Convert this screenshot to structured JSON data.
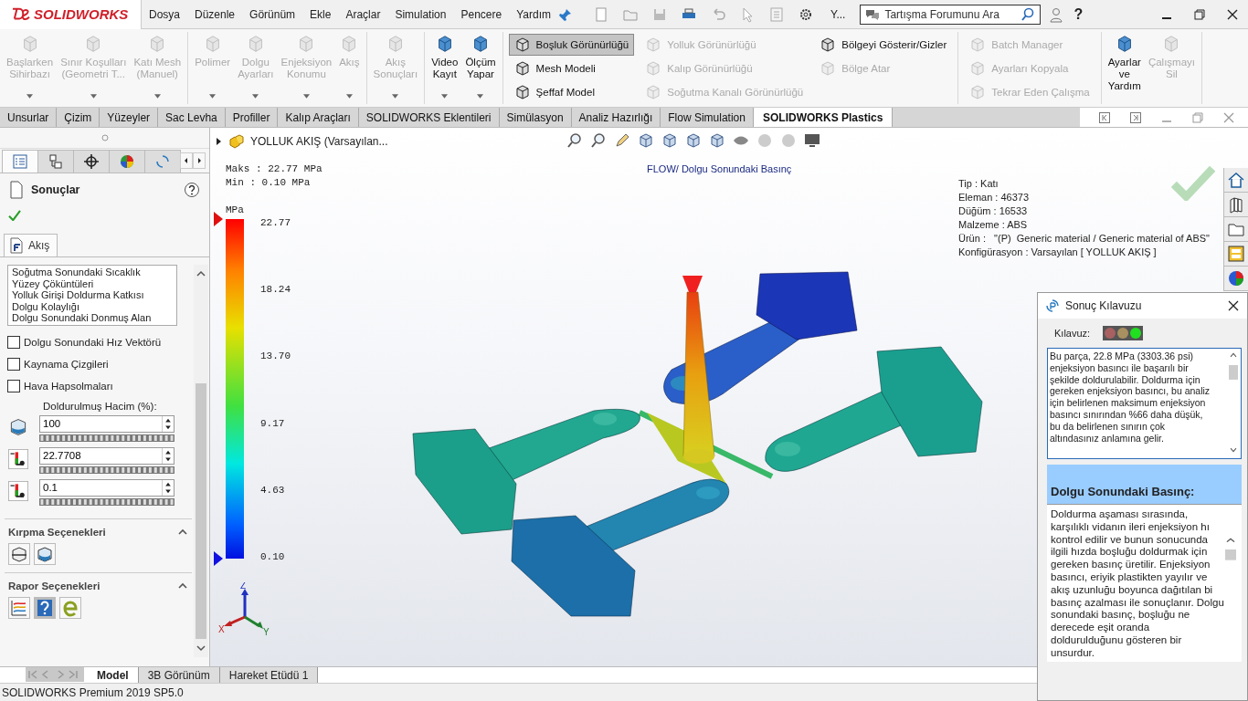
{
  "title_bar": {
    "logo": "SOLIDWORKS",
    "menu": [
      "Dosya",
      "Düzenle",
      "Görünüm",
      "Ekle",
      "Araçlar",
      "Simulation",
      "Pencere",
      "Yardım"
    ],
    "overflow": "Y...",
    "search": {
      "placeholder": "Tartışma Forumunu Ara"
    },
    "help": "?"
  },
  "ribbon": {
    "groups": [
      {
        "kind": "big",
        "items": [
          {
            "label": "Başlarken\nSihirbazı",
            "disabled": true,
            "dropdown": true
          },
          {
            "label": "Sınır Koşulları\n(Geometri T...",
            "disabled": true,
            "dropdown": true
          },
          {
            "label": "Katı Mesh\n(Manuel)",
            "disabled": true,
            "dropdown": true
          }
        ]
      },
      {
        "kind": "big",
        "items": [
          {
            "label": "Polimer",
            "disabled": true,
            "dropdown": true
          },
          {
            "label": "Dolgu\nAyarları",
            "disabled": true,
            "dropdown": true
          },
          {
            "label": "Enjeksiyon\nKonumu",
            "disabled": true,
            "dropdown": true
          },
          {
            "label": "Akış",
            "disabled": true,
            "dropdown": true
          }
        ]
      },
      {
        "kind": "big",
        "items": [
          {
            "label": "Akış\nSonuçları",
            "disabled": true,
            "dropdown": true
          }
        ]
      },
      {
        "kind": "big",
        "items": [
          {
            "label": "Video\nKayıt",
            "disabled": false,
            "dropdown": true
          },
          {
            "label": "Ölçüm\nYapar",
            "disabled": false,
            "dropdown": true
          }
        ]
      },
      {
        "kind": "small",
        "items": [
          {
            "label": "Boşluk Görünürlüğü",
            "disabled": false,
            "selected": true
          },
          {
            "label": "Mesh Modeli",
            "disabled": false,
            "selected": false
          },
          {
            "label": "Şeffaf Model",
            "disabled": false,
            "selected": false
          },
          {
            "label": "Yolluk Görünürlüğü",
            "disabled": true,
            "selected": false
          },
          {
            "label": "Kalıp Görünürlüğü",
            "disabled": true,
            "selected": false
          },
          {
            "label": "Soğutma Kanalı Görünürlüğü",
            "disabled": true,
            "selected": false
          },
          {
            "label": "Bölgeyi Gösterir/Gizler",
            "disabled": false,
            "selected": false
          },
          {
            "label": "Bölge Atar",
            "disabled": true,
            "selected": false
          }
        ]
      },
      {
        "kind": "small",
        "items": [
          {
            "label": "Batch Manager",
            "disabled": true,
            "selected": false
          },
          {
            "label": "Ayarları Kopyala",
            "disabled": true,
            "selected": false
          },
          {
            "label": "Tekrar Eden Çalışma",
            "disabled": true,
            "selected": false
          }
        ]
      },
      {
        "kind": "big",
        "items": [
          {
            "label": "Ayarlar\nve\nYardım",
            "disabled": false,
            "dropdown": false
          },
          {
            "label": "Çalışmayı\nSil",
            "disabled": true,
            "dropdown": false
          }
        ]
      }
    ]
  },
  "command_tabs": [
    {
      "label": "Unsurlar",
      "selected": false
    },
    {
      "label": "Çizim",
      "selected": false
    },
    {
      "label": "Yüzeyler",
      "selected": false
    },
    {
      "label": "Sac Levha",
      "selected": false
    },
    {
      "label": "Profiller",
      "selected": false
    },
    {
      "label": "Kalıp Araçları",
      "selected": false
    },
    {
      "label": "SOLIDWORKS Eklentileri",
      "selected": false
    },
    {
      "label": "Simülasyon",
      "selected": false
    },
    {
      "label": "Analiz Hazırlığı",
      "selected": false
    },
    {
      "label": "Flow Simulation",
      "selected": false
    },
    {
      "label": "SOLIDWORKS Plastics",
      "selected": true
    }
  ],
  "left_panel": {
    "tabs": [
      {
        "selected": true
      },
      {
        "selected": false
      },
      {
        "selected": false
      },
      {
        "selected": false
      },
      {
        "selected": false
      }
    ],
    "title": "Sonuçlar",
    "subtab": "Akış",
    "result_list": [
      "Soğutma Sonundaki Sıcaklık",
      "Yüzey Çöküntüleri",
      "Yolluk Girişi Doldurma Katkısı",
      "Dolgu Kolaylığı",
      "Dolgu Sonundaki Donmuş Alan"
    ],
    "options": [
      {
        "label": "Dolgu Sonundaki Hız Vektörü",
        "checked": false
      },
      {
        "label": "Kaynama Çizgileri",
        "checked": false
      },
      {
        "label": "Hava Hapsolmaları",
        "checked": false
      }
    ],
    "volume_label": "Doldurulmuş Hacim (%):",
    "fields": [
      "100",
      "22.7708",
      "0.1"
    ],
    "sections": [
      {
        "kind": "clip",
        "title": "Kırpma Seçenekleri",
        "expanded": true
      },
      {
        "kind": "report",
        "title": "Rapor Seçenekleri",
        "expanded": true
      }
    ]
  },
  "graphics": {
    "breadcrumb": "YOLLUK AKIŞ  (Varsayılan...",
    "max": "Maks : 22.77 MPa",
    "min": "Min : 0.10 MPa",
    "plot_title": "FLOW/ Dolgu Sonundaki Basınç",
    "legend": {
      "unit": "MPa",
      "ticks": [
        "22.77",
        "18.24",
        "13.70",
        "9.17",
        "4.63",
        "0.10"
      ]
    },
    "info": [
      "Tip : Katı",
      "Eleman : 46373",
      "Düğüm : 16533",
      "Malzeme : ABS",
      "Ürün :   \"(P)  Generic material / Generic material of ABS\"",
      "Konfigürasyon : Varsayılan [ YOLLUK AKIŞ ]"
    ],
    "triad": [
      "X",
      "Y",
      "Z"
    ]
  },
  "doc_tabs": [
    {
      "label": "Model",
      "selected": true
    },
    {
      "label": "3B Görünüm",
      "selected": false
    },
    {
      "label": "Hareket Etüdü 1",
      "selected": false
    }
  ],
  "status": "SOLIDWORKS Premium 2019 SP5.0",
  "result_guide": {
    "title": "Sonuç Kılavuzu",
    "guide_label": "Kılavuz:",
    "lights": [
      {
        "on": false
      },
      {
        "on": false
      },
      {
        "on": true
      }
    ],
    "summary": "Bu parça, 22.8 MPa (3303.36 psi) enjeksiyon basıncı ile başarılı bir şekilde doldurulabilir. Doldurma için gereken enjeksiyon basıncı, bu analiz için belirlenen maksimum enjeksiyon basıncı sınırından %66 daha düşük, bu da belirlenen sınırın çok altındasınız anlamına gelir.",
    "heading": "Dolgu Sonundaki Basınç:",
    "body": "Doldurma aşaması sırasında, karşılıklı vidanın ileri enjeksiyon hı kontrol edilir ve bunun sonucunda ilgili hızda boşluğu doldurmak için gereken basınç üretilir. Enjeksiyon basıncı, eriyik plastikten yayılır ve akış uzunluğu boyunca dağıtılan bi basınç azalması ile sonuçlanır. Dolgu sonundaki basınç, boşluğu ne derecede eşit oranda doldurulduğunu gösteren bir unsurdur."
  }
}
